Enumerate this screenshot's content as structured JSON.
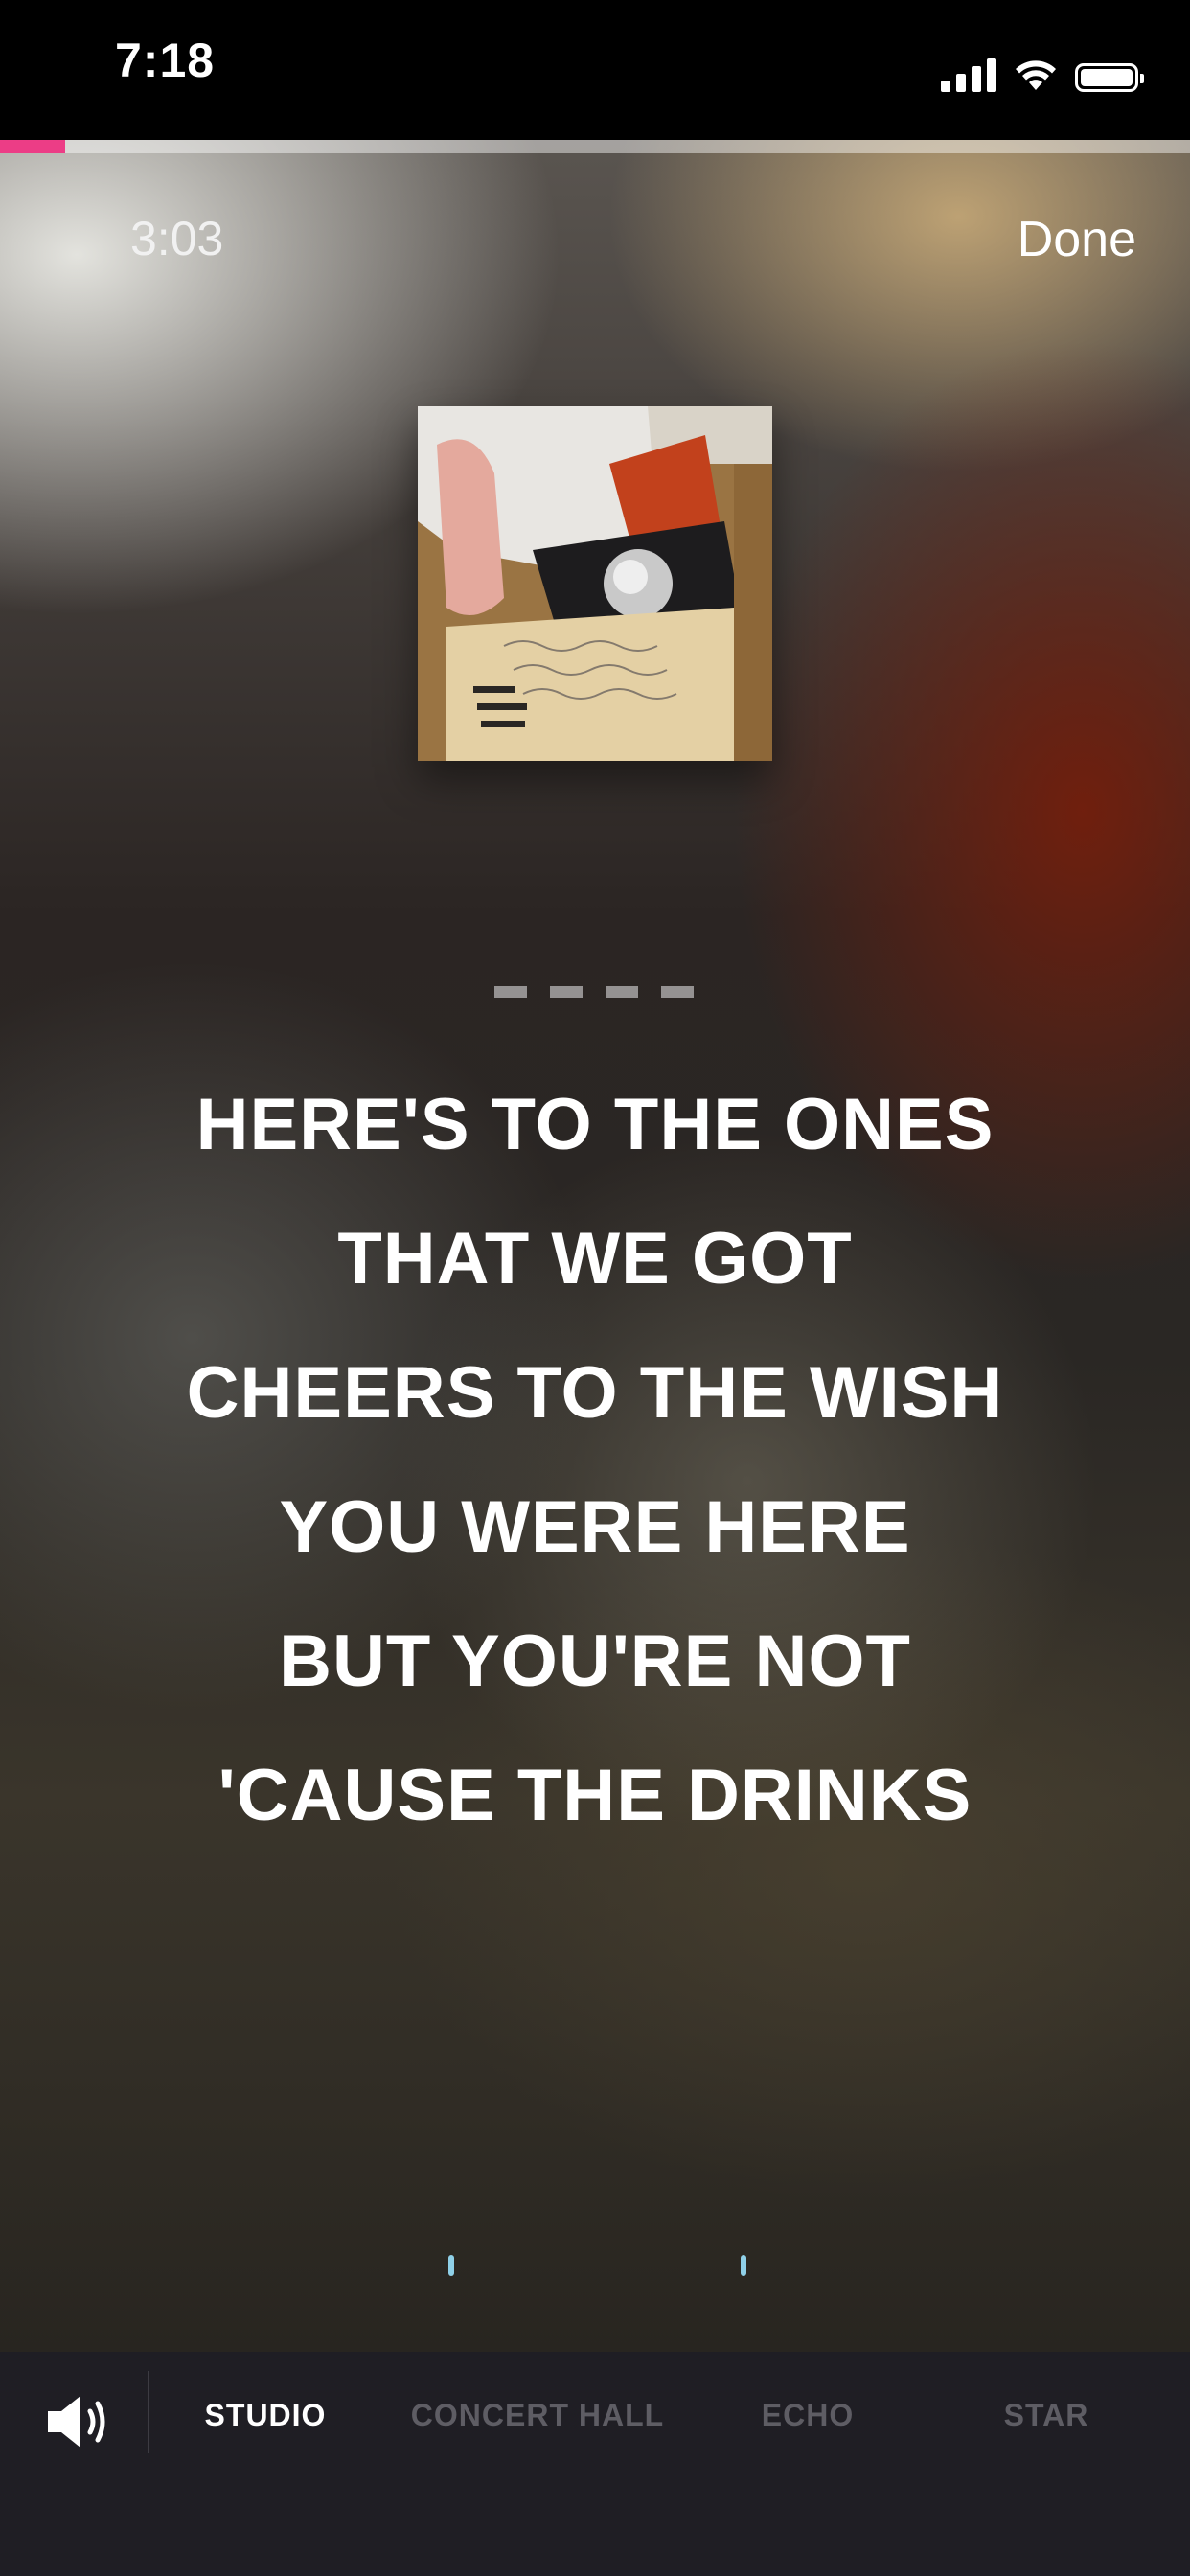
{
  "status_bar": {
    "time": "7:18",
    "icons": [
      "cellular-signal-icon",
      "wifi-icon",
      "battery-icon"
    ]
  },
  "player": {
    "elapsed": "3:03",
    "done_label": "Done",
    "progress_fraction": 0.055,
    "accent_color": "#ec3d86",
    "album_art": "photo of a cardboard box with handwritten label and a hand"
  },
  "countdown_dashes": 4,
  "lyrics": [
    "HERE'S TO THE ONES",
    "THAT WE GOT",
    "CHEERS TO THE WISH",
    "YOU WERE HERE",
    "BUT YOU'RE NOT",
    "'CAUSE THE DRINKS"
  ],
  "effects": {
    "volume_icon": "speaker-volume-icon",
    "tabs": [
      {
        "label": "STUDIO",
        "active": true
      },
      {
        "label": "CONCERT HALL",
        "active": false
      },
      {
        "label": "ECHO",
        "active": false
      },
      {
        "label": "STAR",
        "active": false
      }
    ]
  }
}
